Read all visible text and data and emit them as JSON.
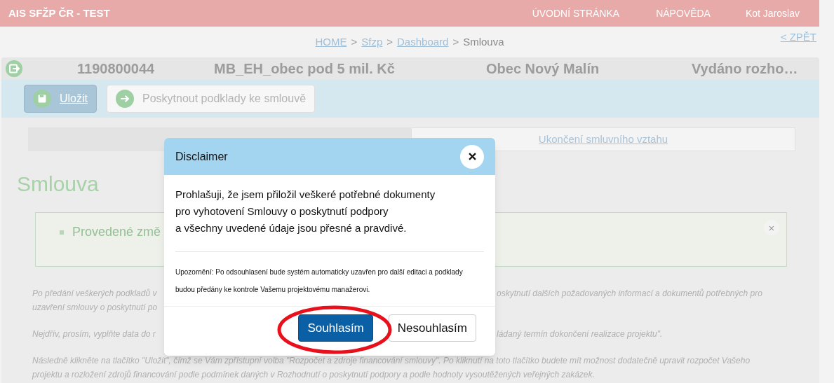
{
  "header": {
    "app_title": "AIS SFŽP ČR - TEST",
    "nav": [
      "ÚVODNÍ STRÁNKA",
      "NÁPOVĚDA",
      "Kot Jaroslav"
    ]
  },
  "breadcrumb": {
    "links": [
      "HOME",
      "Sfzp",
      "Dashboard"
    ],
    "current": "Smlouva",
    "separator": ">",
    "back": "< ZPĚT"
  },
  "record": {
    "number": "1190800044",
    "name": "MB_EH_obec pod 5 mil. Kč",
    "applicant": "Obec Nový Malín",
    "status": "Vydáno rozho…"
  },
  "toolbar": [
    {
      "label": "Uložit",
      "kind": "primary",
      "disabled": false
    },
    {
      "label": "Poskytnout podklady ke smlouvě",
      "kind": "secondary",
      "disabled": true
    }
  ],
  "tabs": [
    {
      "selected": true
    },
    {
      "label": "Ukončení smluvního vztahu",
      "selected": false
    }
  ],
  "page_title": "Smlouva",
  "alert": {
    "text": "Provedené změ",
    "close": "×"
  },
  "paragraphs": [
    {
      "lines": [
        {
          "left": "Po předání veškerých podkladů v",
          "right": "oskytnutí dalších požadovaných informací a dokumentů potřebných pro"
        },
        {
          "left": "uzavření smlouvy o poskytnutí po"
        }
      ]
    },
    {
      "lines": [
        {
          "left": "Nejdřív, prosím, vyplňte data do r",
          "right": "ládaný termín dokončení realizace projektu\"."
        }
      ]
    },
    {
      "lines": [
        {
          "full": "Následně klikněte na tlačítko \"Uložit\", čímž se Vám zpřístupní volba \"Rozpočet a zdroje financování smlouvy\". Po kliknutí na toto tlačítko budete mít možnost dodatečně upravit rozpočet Vašeho"
        },
        {
          "full": "projektu a rozložení zdrojů financování podle podmínek daných v Rozhodnutí o poskytnutí podpory a podle hodnoty vysoutěžených veřejných zakázek."
        }
      ]
    }
  ],
  "dialog": {
    "title": "Disclaimer",
    "body_lines": [
      "Prohlašuji, že jsem přiložil veškeré potřebné dokumenty",
      "pro vyhotovení Smlouvy o poskytnutí podpory",
      "a všechny uvedené údaje jsou přesné a pravdivé."
    ],
    "notice_lines": [
      "Upozornění: Po odsouhlasení bude systém automaticky uzavřen pro další editaci a podklady",
      "budou předány ke kontrole Vašemu projektovému manažerovi."
    ],
    "buttons": [
      {
        "label": "Souhlasím",
        "kind": "primary"
      },
      {
        "label": "Nesouhlasím",
        "kind": "secondary"
      }
    ]
  }
}
